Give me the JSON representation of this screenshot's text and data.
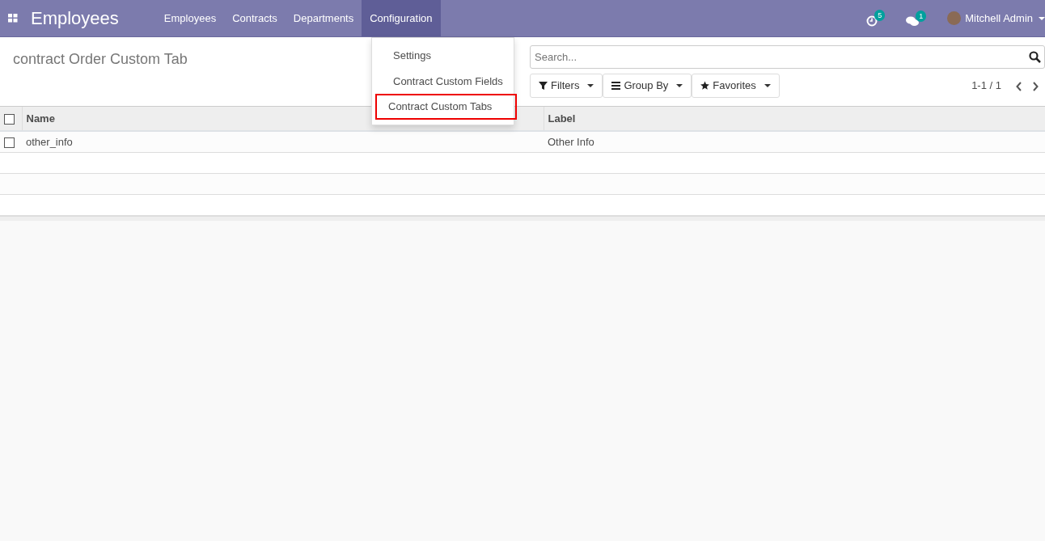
{
  "app_title": "Employees",
  "menu": [
    {
      "label": "Employees",
      "selected": false
    },
    {
      "label": "Contracts",
      "selected": false
    },
    {
      "label": "Departments",
      "selected": false
    },
    {
      "label": "Configuration",
      "selected": true
    }
  ],
  "dropdown": [
    {
      "label": "Settings",
      "highlighted": false
    },
    {
      "label": "Contract Custom Fields",
      "highlighted": false
    },
    {
      "label": "Contract Custom Tabs",
      "highlighted": true
    }
  ],
  "systray": {
    "activity_count": "5",
    "message_count": "1",
    "user": "Mitchell Admin"
  },
  "breadcrumb": "contract Order Custom Tab",
  "search": {
    "placeholder": "Search..."
  },
  "filters": [
    {
      "kind": "filter",
      "label": "Filters"
    },
    {
      "kind": "group",
      "label": "Group By"
    },
    {
      "kind": "star",
      "label": "Favorites"
    }
  ],
  "pager": "1-1 / 1",
  "table": {
    "columns": [
      "Name",
      "Label"
    ],
    "rows": [
      {
        "checked": false,
        "cells": [
          "other_info",
          "Other Info"
        ]
      }
    ],
    "select_all_checked": false
  }
}
